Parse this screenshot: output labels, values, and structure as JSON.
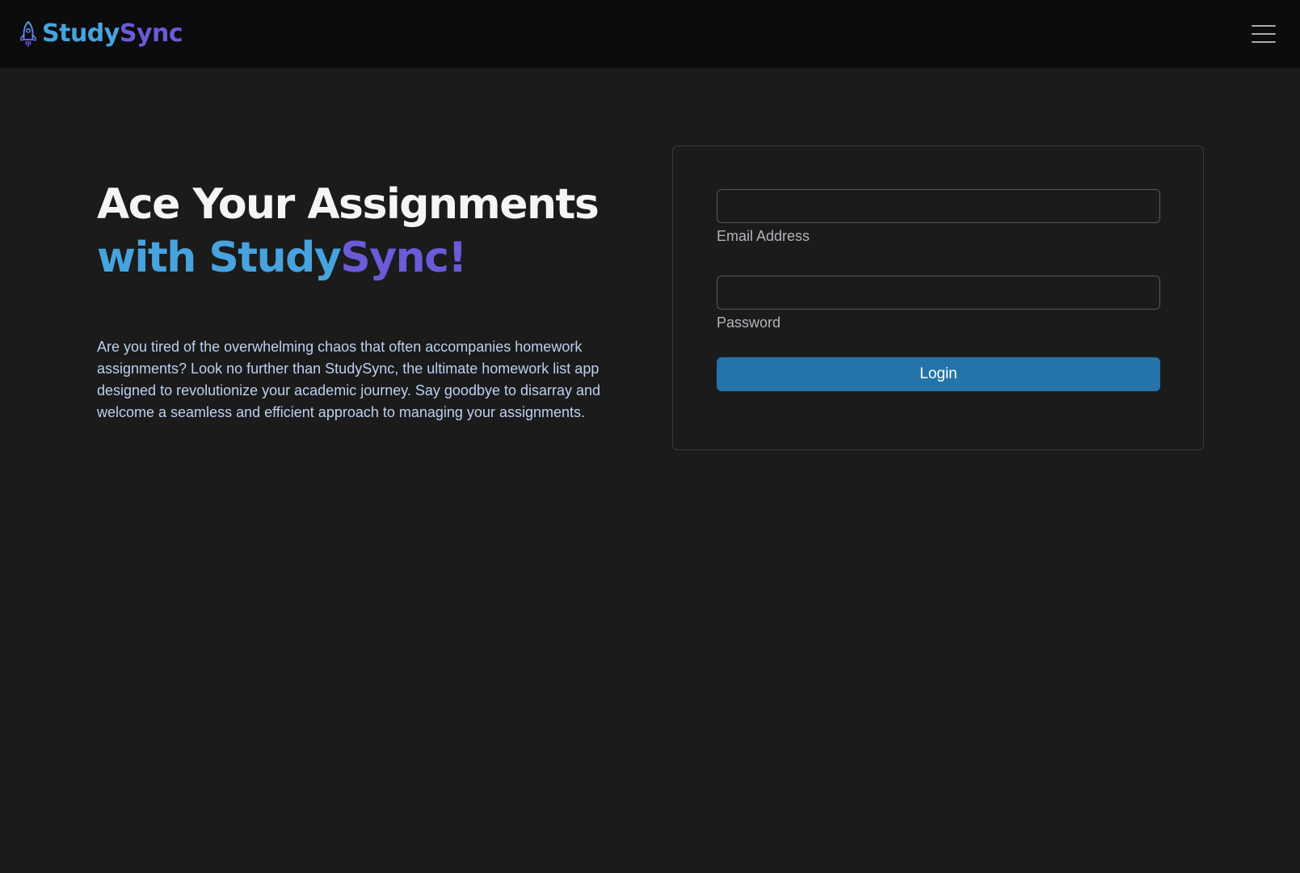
{
  "brand": {
    "icon": "rocket-icon",
    "name_part1": "Study",
    "name_part2": "Sync",
    "color_primary": "#47a3dd",
    "color_secondary": "#6a5bd8"
  },
  "nav": {
    "menu_icon": "hamburger-menu-icon"
  },
  "hero": {
    "title_line1": "Ace Your Assignments",
    "title_line2_part1": "with ",
    "title_line2_part2": "Study",
    "title_line2_part3": "Sync!",
    "description": "Are you tired of the overwhelming chaos that often accompanies homework assignments? Look no further than StudySync, the ultimate homework list app designed to revolutionize your academic journey. Say goodbye to disarray and welcome a seamless and efficient approach to managing your assignments."
  },
  "login_form": {
    "email": {
      "label": "Email Address",
      "value": ""
    },
    "password": {
      "label": "Password",
      "value": ""
    },
    "submit_label": "Login",
    "button_color": "#2474a9"
  },
  "colors": {
    "page_background": "#1b1b1c",
    "navbar_background": "#0c0c0d"
  }
}
